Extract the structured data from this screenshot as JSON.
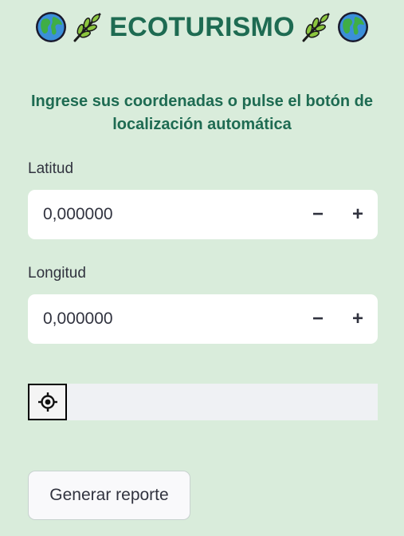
{
  "header": {
    "title": "ECOTURISMO",
    "left_icons": [
      "globe-icon",
      "herb-icon"
    ],
    "right_icons": [
      "herb-icon",
      "globe-icon"
    ]
  },
  "instructions": "Ingrese sus coordenadas o pulse el botón de localización automática",
  "latitude": {
    "label": "Latitud",
    "value": "0,000000",
    "decrement": "−",
    "increment": "+"
  },
  "longitude": {
    "label": "Longitud",
    "value": "0,000000",
    "decrement": "−",
    "increment": "+"
  },
  "locate": {
    "icon": "crosshair-icon"
  },
  "actions": {
    "report_label": "Generar reporte"
  },
  "colors": {
    "background": "#d9ecdb",
    "accent": "#1e6b52",
    "text": "#31333f"
  }
}
